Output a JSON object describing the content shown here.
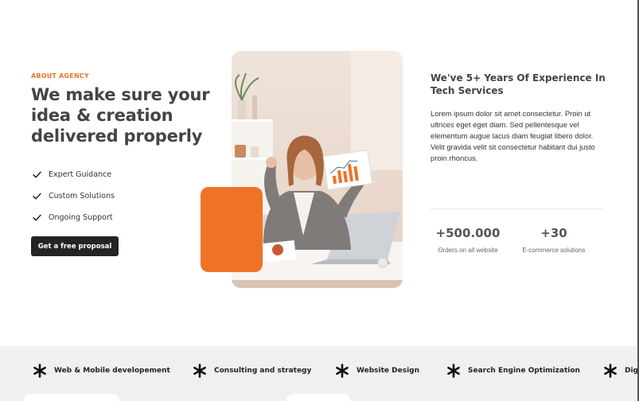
{
  "about": {
    "eyebrow": "ABOUT AGENCY",
    "headline": "We make sure your idea & creation delivered properly",
    "features": [
      "Expert Guidance",
      "Custom Solutions",
      "Ongoing Support"
    ],
    "cta_label": "Get a free proposal"
  },
  "experience": {
    "title": "We've 5+ Years Of Experience In Tech Services",
    "body": "Lorem ipsum dolor sit amet consectetur. Proin ut ultrices eget eget diam. Sed pellentesque vel elementum augue lacus diam feugiat libero dolor. Velit gravida velit sit consectetur habitant dui justo proin rhoncus."
  },
  "stats": [
    {
      "value": "+500.000",
      "label": "Orders on all website"
    },
    {
      "value": "+30",
      "label": "E-commerce solutions"
    }
  ],
  "services": [
    "Web & Mobile developement",
    "Consulting and strategy",
    "Website Design",
    "Search Engine Optimization",
    "Dig"
  ],
  "icons": {
    "feature": "check-icon",
    "service": "asterisk-icon"
  },
  "colors": {
    "accent": "#ee7326",
    "dark": "#242424",
    "band_bg": "#f0f0f0",
    "text": "#444444"
  }
}
